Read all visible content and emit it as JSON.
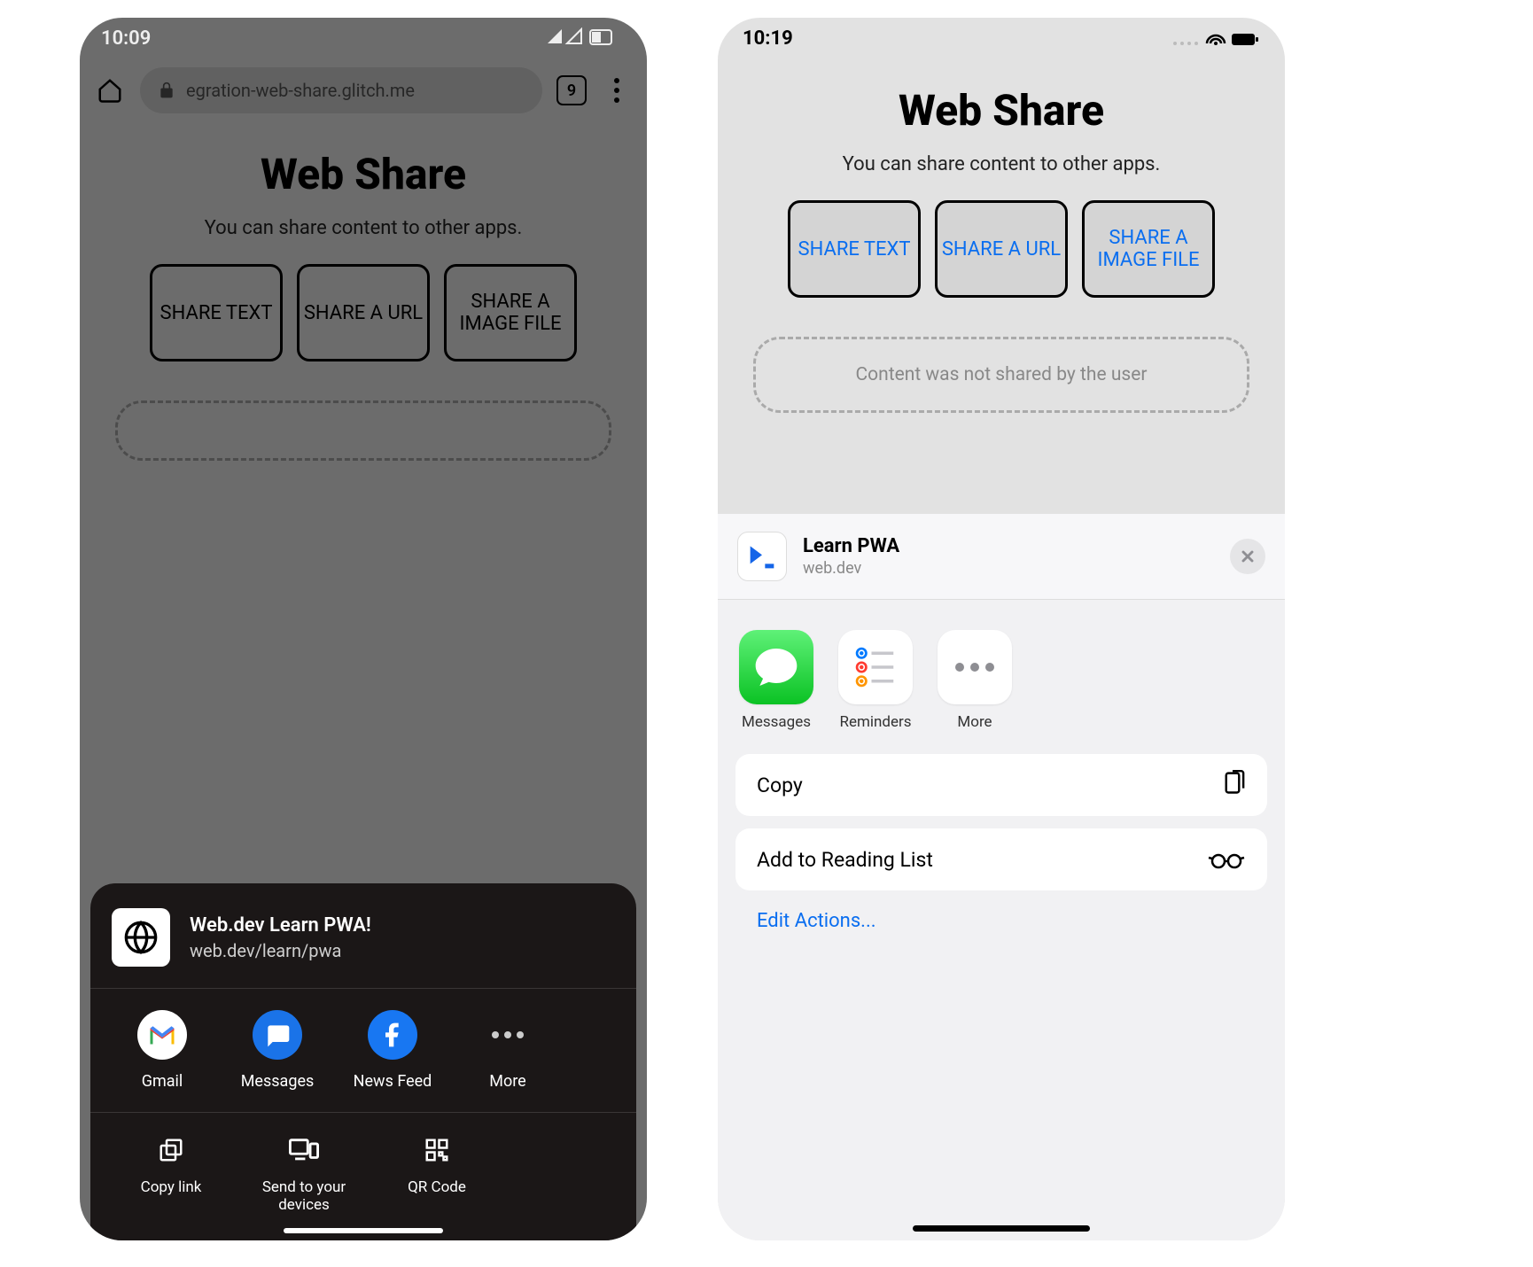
{
  "android": {
    "status": {
      "time": "10:09"
    },
    "url": "egration-web-share.glitch.me",
    "tabs": "9",
    "page": {
      "title": "Web Share",
      "subtitle": "You can share content to other apps.",
      "buttons": [
        "SHARE TEXT",
        "SHARE A URL",
        "SHARE A IMAGE FILE"
      ]
    },
    "sheet": {
      "title": "Web.dev Learn PWA!",
      "subtitle": "web.dev/learn/pwa",
      "apps": [
        "Gmail",
        "Messages",
        "News Feed",
        "More"
      ],
      "actions": [
        "Copy link",
        "Send to your devices",
        "QR Code"
      ]
    }
  },
  "ios": {
    "status": {
      "time": "10:19"
    },
    "page": {
      "title": "Web Share",
      "subtitle": "You can share content to other apps.",
      "buttons": [
        "SHARE TEXT",
        "SHARE A URL",
        "SHARE A IMAGE FILE"
      ],
      "result": "Content was not shared by the user"
    },
    "sheet": {
      "title": "Learn PWA",
      "subtitle": "web.dev",
      "apps": [
        "Messages",
        "Reminders",
        "More"
      ],
      "actions": [
        "Copy",
        "Add to Reading List"
      ],
      "edit": "Edit Actions..."
    }
  }
}
